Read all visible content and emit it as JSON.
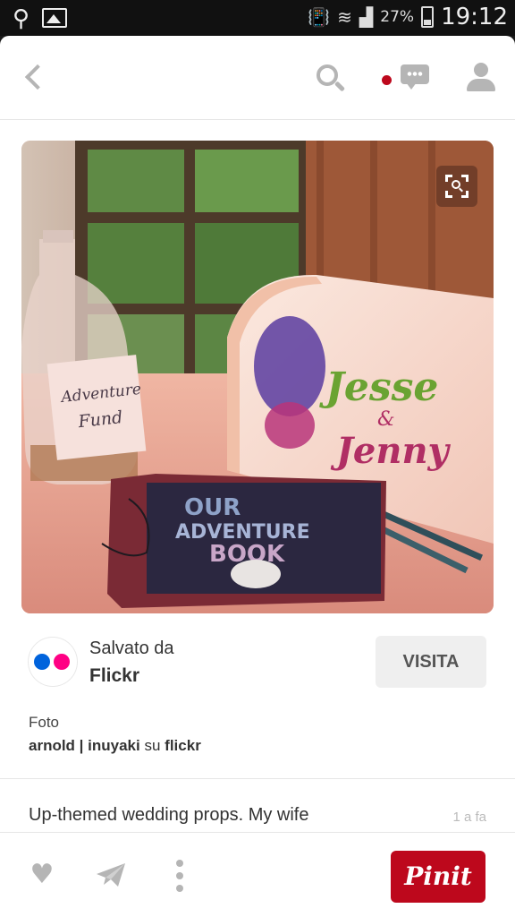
{
  "status_bar": {
    "battery": "27%",
    "time": "19:12",
    "icons": [
      "usb-icon",
      "image-icon",
      "vibrate-icon",
      "wifi-icon",
      "signal-icon",
      "battery-icon"
    ]
  },
  "top_bar": {
    "icons": [
      "back-icon",
      "search-icon",
      "notification-dot",
      "chat-icon",
      "profile-icon"
    ]
  },
  "pin_image": {
    "jar_label": "Adventure Fund",
    "mailbox_text": "Jesse & Jenny",
    "book_title": "OUR ADVENTURE BOOK"
  },
  "source": {
    "saved_label": "Salvato da",
    "name": "Flickr",
    "visit_label": "VISITA"
  },
  "credit": {
    "label": "Foto",
    "author": "arnold | inuyaki",
    "via": "su",
    "site": "flickr"
  },
  "description": {
    "text": "Up-themed wedding props. My wife",
    "time_ago": "1 a fa"
  },
  "bottom_bar": {
    "pin_label": "Pinit"
  },
  "colors": {
    "pinterest_red": "#bd081c",
    "flickr_blue": "#0063dc",
    "flickr_pink": "#ff0084",
    "icon_grey": "#b5b5b5"
  }
}
